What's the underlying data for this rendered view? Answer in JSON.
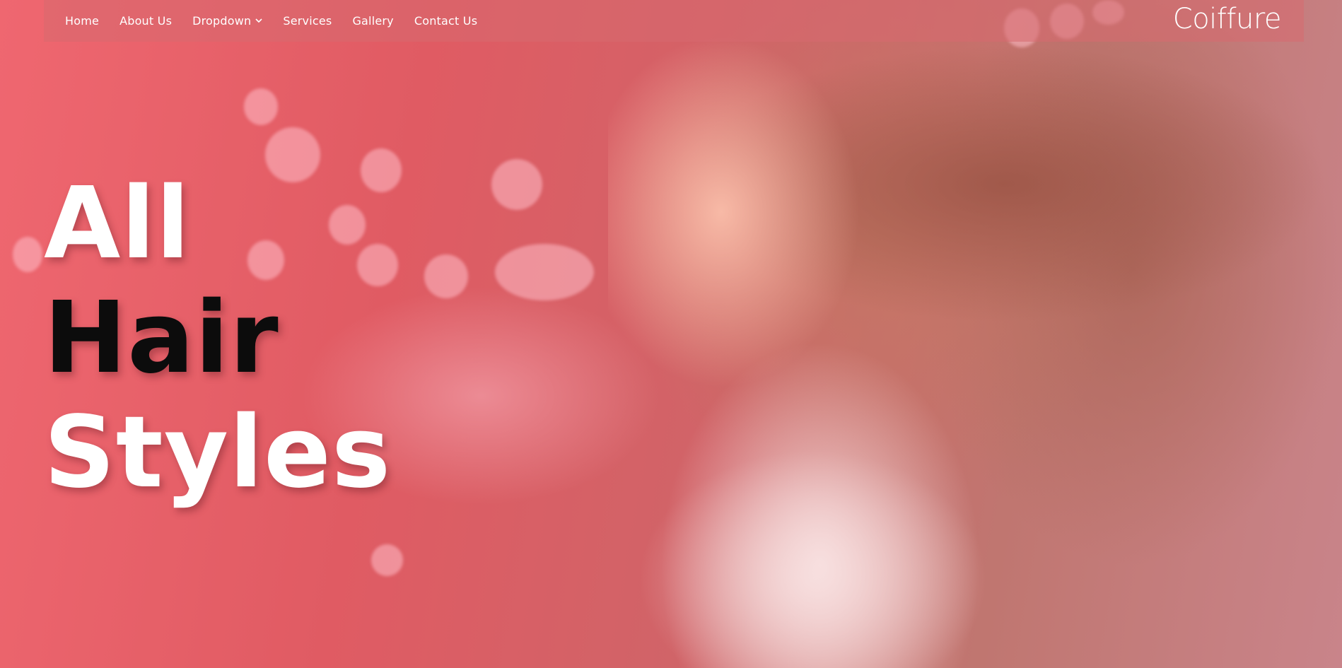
{
  "nav": {
    "items": [
      {
        "label": "Home"
      },
      {
        "label": "About Us"
      },
      {
        "label": "Dropdown",
        "has_dropdown": true
      },
      {
        "label": "Services"
      },
      {
        "label": "Gallery"
      },
      {
        "label": "Contact Us"
      }
    ],
    "dropdown_icon": "chevron-down-icon",
    "brand": "Coiffure"
  },
  "hero": {
    "headline": [
      "All",
      "Hair",
      "Styles"
    ],
    "headline_colors": [
      "#ffffff",
      "#0c0c0c",
      "#ffffff"
    ],
    "overlay_color": "#e8606a"
  }
}
